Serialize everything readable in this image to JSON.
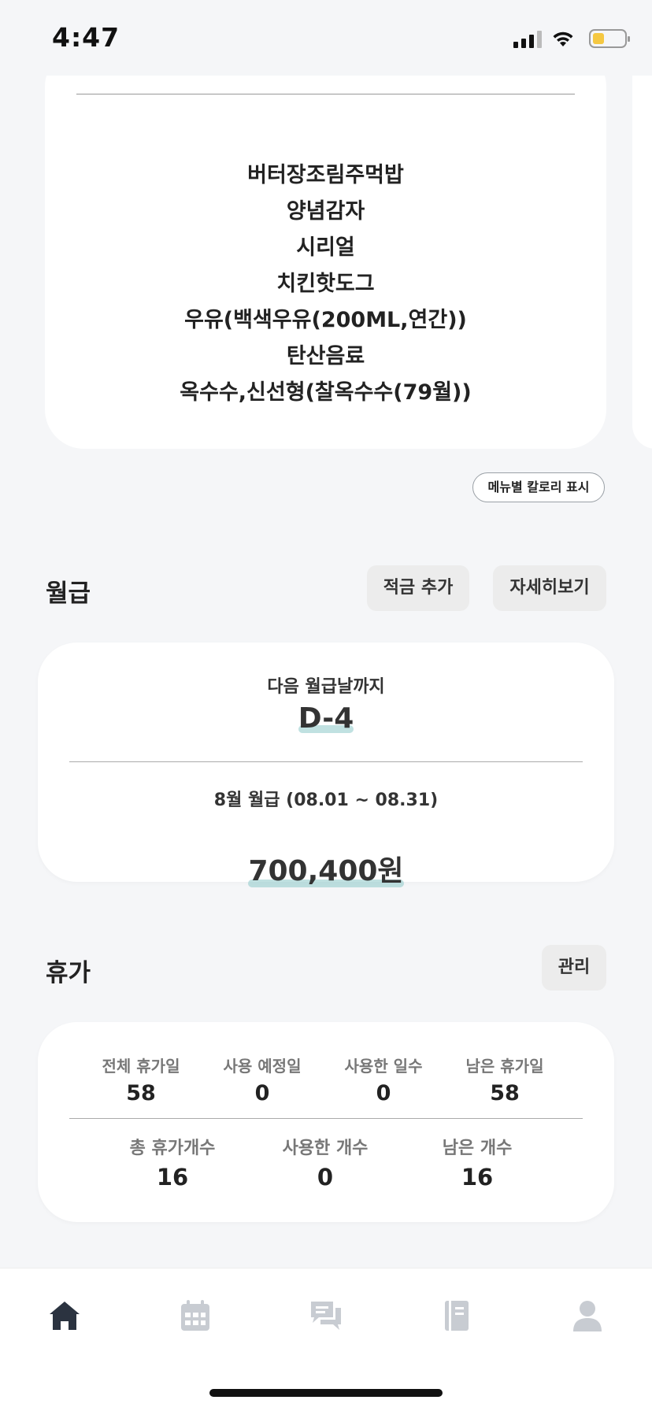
{
  "status_bar": {
    "time": "4:47"
  },
  "meal": {
    "items": [
      "버터장조림주먹밥",
      "양념감자",
      "시리얼",
      "치킨핫도그",
      "우유(백색우유(200ML,연간))",
      "탄산음료",
      "옥수수,신선형(찰옥수수(79월))"
    ],
    "calorie_button": "메뉴별 칼로리 표시"
  },
  "salary": {
    "title": "월급",
    "add_savings_button": "적금 추가",
    "details_button": "자세히보기",
    "next_payday_label": "다음 월급날까지",
    "d_day": "D-4",
    "period_label": "8월 월급 (08.01 ~ 08.31)",
    "amount": "700,400원"
  },
  "vacation": {
    "title": "휴가",
    "manage_button": "관리",
    "row1": [
      {
        "label": "전체 휴가일",
        "value": "58"
      },
      {
        "label": "사용 예정일",
        "value": "0"
      },
      {
        "label": "사용한 일수",
        "value": "0"
      },
      {
        "label": "남은 휴가일",
        "value": "58"
      }
    ],
    "row2": [
      {
        "label": "총 휴가개수",
        "value": "16"
      },
      {
        "label": "사용한 개수",
        "value": "0"
      },
      {
        "label": "남은 개수",
        "value": "16"
      }
    ]
  },
  "nav": {
    "items": [
      "home-icon",
      "calendar-icon",
      "chat-icon",
      "notebook-icon",
      "profile-icon"
    ],
    "active_color": "#2b3340",
    "inactive_color": "#c8ccd2"
  }
}
